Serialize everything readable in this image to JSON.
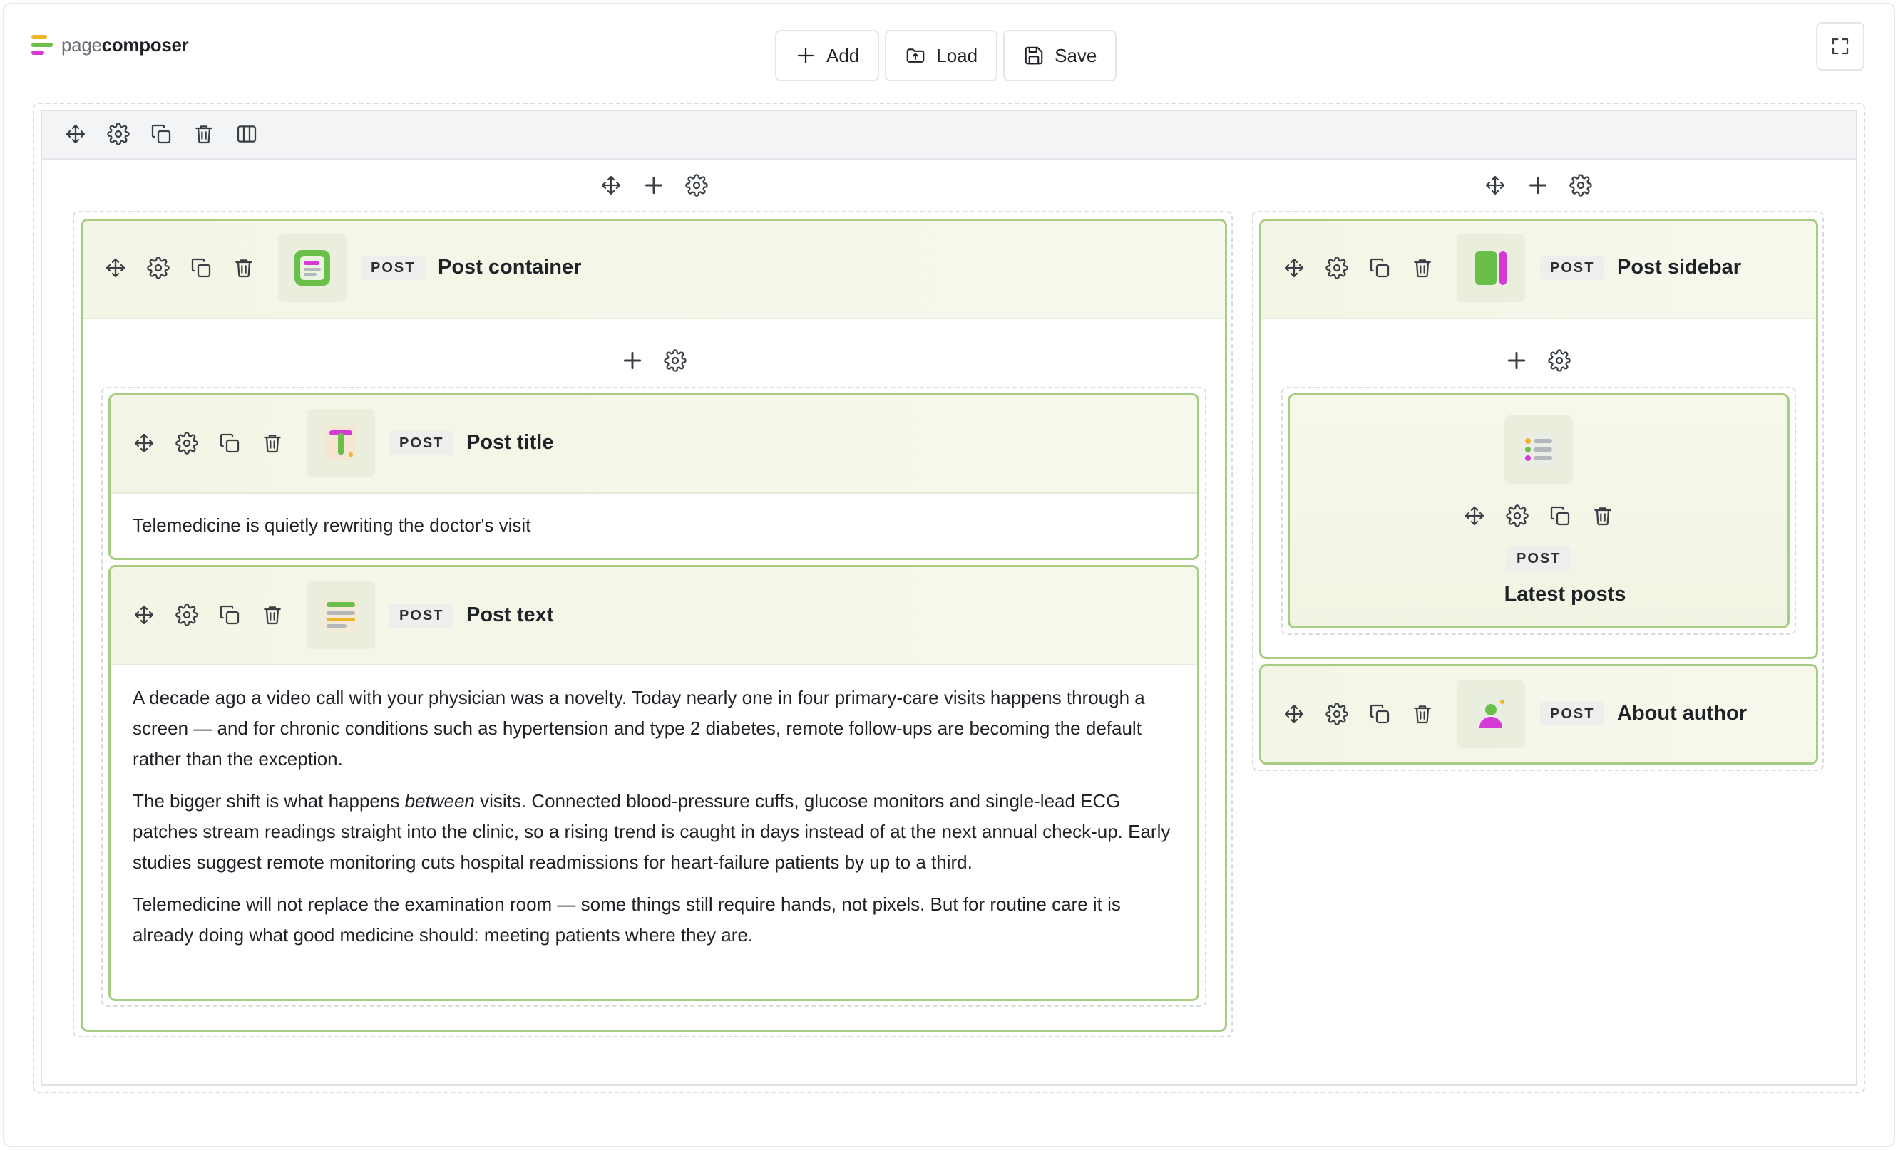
{
  "app": {
    "logo_light": "page",
    "logo_bold": "composer"
  },
  "toolbar": {
    "add_label": "Add",
    "load_label": "Load",
    "save_label": "Save"
  },
  "blocks": {
    "post_container": {
      "badge": "POST",
      "title": "Post container"
    },
    "post_title": {
      "badge": "POST",
      "title": "Post title",
      "content": "Telemedicine is quietly rewriting the doctor's visit"
    },
    "post_text": {
      "badge": "POST",
      "title": "Post text",
      "p1": "A decade ago a video call with your physician was a novelty. Today nearly one in four primary-care visits happens through a screen — and for chronic conditions such as hypertension and type 2 diabetes, remote follow-ups are becoming the default rather than the exception.",
      "p2_before": "The bigger shift is what happens ",
      "p2_em": "between",
      "p2_after": " visits. Connected blood-pressure cuffs, glucose monitors and single-lead ECG patches stream readings straight into the clinic, so a rising trend is caught in days instead of at the next annual check-up. Early studies suggest remote monitoring cuts hospital readmissions for heart-failure patients by up to a third.",
      "p3": "Telemedicine will not replace the examination room — some things still require hands, not pixels. But for routine care it is already doing what good medicine should: meeting patients where they are."
    },
    "post_sidebar": {
      "badge": "POST",
      "title": "Post sidebar"
    },
    "latest_posts": {
      "badge": "POST",
      "title": "Latest posts"
    },
    "about_author": {
      "badge": "POST",
      "title": "About author"
    }
  },
  "colors": {
    "accent_green": "#6abf4b",
    "accent_magenta": "#d63ad6",
    "block_border": "#a8cc84"
  }
}
